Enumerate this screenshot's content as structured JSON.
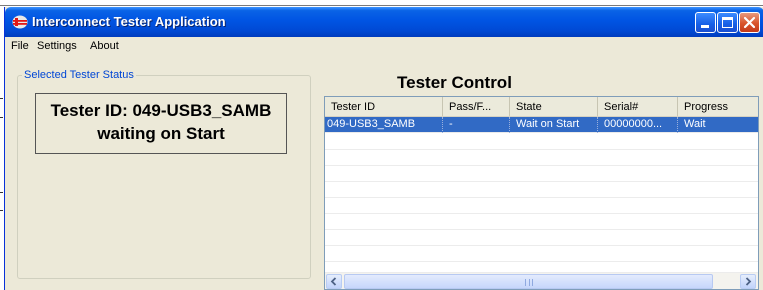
{
  "window": {
    "title": "Interconnect Tester Application",
    "colors": {
      "titlebar": "#0054e3",
      "close": "#d9542b",
      "selection": "#316ac5",
      "legend_text": "#0046d5"
    }
  },
  "menu": {
    "items": [
      "File",
      "Settings",
      "About"
    ]
  },
  "status_panel": {
    "legend": "Selected Tester Status",
    "line1": "Tester ID: 049-USB3_SAMB",
    "line2": "waiting on Start"
  },
  "control": {
    "title": "Tester Control",
    "columns": [
      "Tester ID",
      "Pass/F...",
      "State",
      "Serial#",
      "Progress"
    ],
    "rows": [
      {
        "tester_id": "049-USB3_SAMB",
        "pass_fail": "-",
        "state": "Wait on Start",
        "serial": "00000000...",
        "progress": "Wait",
        "selected": true
      }
    ]
  },
  "icons": {
    "app": "app-logo-icon",
    "minimize": "minimize-icon",
    "maximize": "maximize-icon",
    "close": "close-icon",
    "scroll_left": "scroll-left-arrow-icon",
    "scroll_right": "scroll-right-arrow-icon"
  }
}
